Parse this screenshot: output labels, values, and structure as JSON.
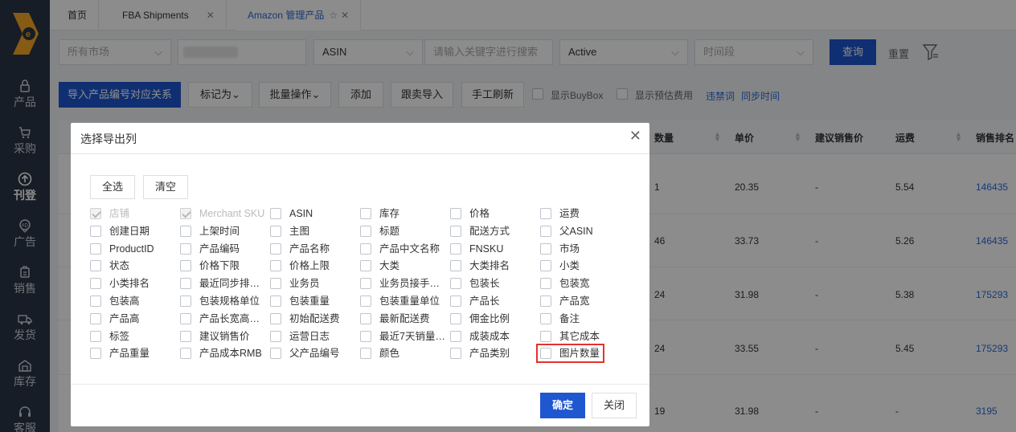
{
  "sidebar": {
    "items": [
      {
        "label": "产品",
        "icon": "lock-icon"
      },
      {
        "label": "采购",
        "icon": "cart-icon"
      },
      {
        "label": "刊登",
        "icon": "upload-icon"
      },
      {
        "label": "广告",
        "icon": "ad-icon"
      },
      {
        "label": "销售",
        "icon": "sales-icon"
      },
      {
        "label": "发货",
        "icon": "truck-icon"
      },
      {
        "label": "库存",
        "icon": "warehouse-icon"
      },
      {
        "label": "客服",
        "icon": "headset-icon"
      }
    ]
  },
  "tabs": [
    {
      "label": "首页"
    },
    {
      "label": "FBA Shipments"
    },
    {
      "label": "Amazon 管理产品"
    }
  ],
  "filters": {
    "market": "所有市场",
    "asin": "ASIN",
    "keyword_placeholder": "请输入关键字进行搜索",
    "status": "Active",
    "time": "时间段",
    "query": "查询",
    "reset": "重置"
  },
  "toolbar": {
    "import": "导入产品编号对应关系",
    "mark": "标记为",
    "batch": "批量操作",
    "add": "添加",
    "follow_import": "跟卖导入",
    "manual_refresh": "手工刷新",
    "show_buybox": "显示BuyBox",
    "show_fees": "显示预估费用",
    "banned_words": "违禁词",
    "sync_time": "同步时间"
  },
  "table": {
    "headers": [
      "数量",
      "单价",
      "建议销售价",
      "运费",
      "销售排名"
    ],
    "rows": [
      {
        "qty": "1",
        "price": "20.35",
        "suggest": "-",
        "ship": "5.54",
        "rank": "146435"
      },
      {
        "qty": "46",
        "price": "33.73",
        "suggest": "-",
        "ship": "5.26",
        "rank": "146435"
      },
      {
        "qty": "24",
        "price": "31.98",
        "suggest": "-",
        "ship": "5.38",
        "rank": "175293"
      },
      {
        "qty": "24",
        "price": "33.55",
        "suggest": "-",
        "ship": "5.45",
        "rank": "175293"
      },
      {
        "qty": "19",
        "price": "31.98",
        "suggest": "-",
        "ship": "-",
        "rank": "3195"
      }
    ]
  },
  "modal": {
    "title": "选择导出列",
    "select_all": "全选",
    "clear": "清空",
    "confirm": "确定",
    "close": "关闭",
    "columns": [
      [
        "店铺",
        "Merchant SKU",
        "ASIN",
        "库存",
        "价格",
        "运费"
      ],
      [
        "创建日期",
        "上架时间",
        "主图",
        "标题",
        "配送方式",
        "父ASIN"
      ],
      [
        "ProductID",
        "产品编码",
        "产品名称",
        "产品中文名称",
        "FNSKU",
        "市场"
      ],
      [
        "状态",
        "价格下限",
        "价格上限",
        "大类",
        "大类排名",
        "小类"
      ],
      [
        "小类排名",
        "最近同步排…",
        "业务员",
        "业务员接手…",
        "包装长",
        "包装宽"
      ],
      [
        "包装高",
        "包装规格单位",
        "包装重量",
        "包装重量单位",
        "产品长",
        "产品宽"
      ],
      [
        "产品高",
        "产品长宽高…",
        "初始配送费",
        "最新配送费",
        "佣金比例",
        "备注"
      ],
      [
        "标签",
        "建议销售价",
        "运营日志",
        "最近7天销量…",
        "成装成本",
        "其它成本"
      ],
      [
        "产品重量",
        "产品成本RMB",
        "父产品编号",
        "颜色",
        "产品类别",
        "图片数量"
      ]
    ]
  }
}
